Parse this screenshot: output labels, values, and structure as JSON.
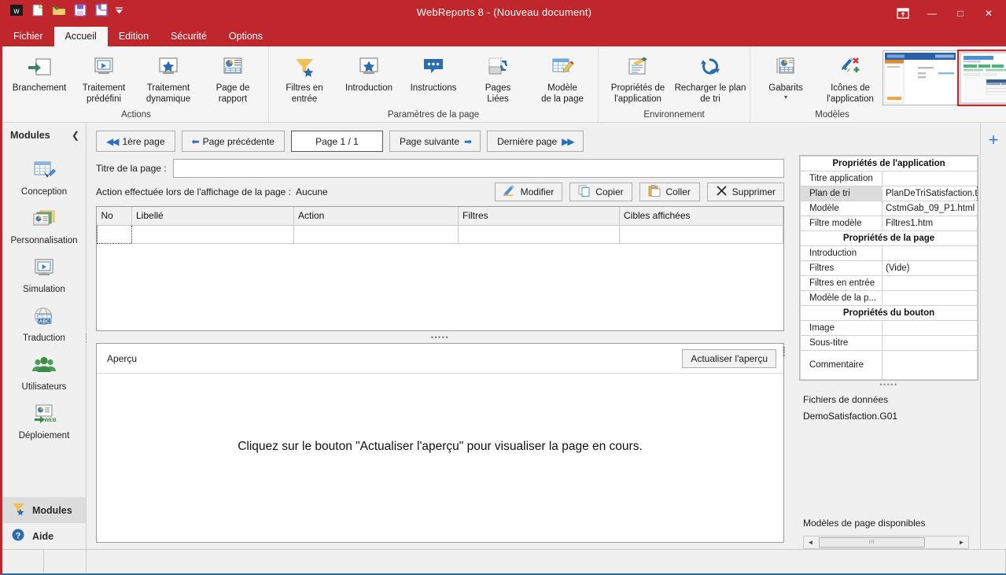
{
  "window": {
    "title": "WebReports 8 - (Nouveau document)",
    "quick_access": [
      "app-logo-icon",
      "new-document-icon",
      "open-folder-icon",
      "save-icon",
      "save-as-icon",
      "customize-qat-caret-icon"
    ],
    "controls": {
      "ribbon_display": "ribbon-display-options-icon",
      "minimize": "—",
      "maximize": "□",
      "close": "✕"
    }
  },
  "menu": {
    "tabs": [
      {
        "label": "Fichier",
        "active": false
      },
      {
        "label": "Accueil",
        "active": true
      },
      {
        "label": "Edition",
        "active": false
      },
      {
        "label": "Sécurité",
        "active": false
      },
      {
        "label": "Options",
        "active": false
      }
    ]
  },
  "ribbon": {
    "groups": [
      {
        "label": "Actions",
        "items": [
          {
            "label": "Branchement",
            "icon": "branch-icon",
            "caret": false
          },
          {
            "label": "Traitement\nprédéfini",
            "icon": "predefined-process-icon",
            "caret": false
          },
          {
            "label": "Traitement\ndynamique",
            "icon": "dynamic-process-icon",
            "caret": false
          },
          {
            "label": "Page de\nrapport",
            "icon": "report-page-icon",
            "caret": false
          }
        ]
      },
      {
        "label": "Paramètres de la page",
        "items": [
          {
            "label": "Filtres en\nentrée",
            "icon": "input-filters-icon",
            "caret": false
          },
          {
            "label": "Introduction",
            "icon": "introduction-icon",
            "caret": false
          },
          {
            "label": "Instructions",
            "icon": "instructions-icon",
            "caret": false
          },
          {
            "label": "Pages\nLiées",
            "icon": "linked-pages-icon",
            "caret": false
          },
          {
            "label": "Modèle\nde la page",
            "icon": "page-template-icon",
            "caret": false
          }
        ]
      },
      {
        "label": "Environnement",
        "items": [
          {
            "label": "Propriétés de\nl'application",
            "icon": "application-properties-icon",
            "caret": false
          },
          {
            "label": "Recharger le\nplan de tri",
            "icon": "reload-sort-plan-icon",
            "caret": false
          }
        ]
      },
      {
        "label": "Modèles",
        "items": [
          {
            "label": "Gabarits",
            "icon": "templates-icon",
            "caret": true
          },
          {
            "label": "Icônes de\nl'application",
            "icon": "application-icons-icon",
            "caret": false
          }
        ],
        "gallery": {
          "thumbnails": [
            {
              "name": "template-thumb-1",
              "selected": false
            },
            {
              "name": "template-thumb-2",
              "selected": true
            }
          ],
          "scroll": [
            "▲",
            "▼",
            "▼"
          ]
        }
      }
    ],
    "collapse_icon": "collapse-ribbon-icon"
  },
  "sidebar": {
    "title": "Modules",
    "collapse_icon": "chevron-left-icon",
    "items": [
      {
        "label": "Conception",
        "icon": "design-grid-icon"
      },
      {
        "label": "Personnalisation",
        "icon": "customization-icon"
      },
      {
        "label": "Simulation",
        "icon": "simulation-screen-icon"
      },
      {
        "label": "Traduction",
        "icon": "translation-globe-abc-icon"
      },
      {
        "label": "Utilisateurs",
        "icon": "users-group-icon"
      },
      {
        "label": "Déploiement",
        "icon": "deployment-web-icon"
      }
    ],
    "bottom": [
      {
        "label": "Modules",
        "icon": "modules-funnel-icon",
        "active": true
      },
      {
        "label": "Aide",
        "icon": "help-question-icon",
        "active": false
      }
    ]
  },
  "center": {
    "pager": {
      "first": "1ère page",
      "previous": "Page précédente",
      "indicator": "Page 1 / 1",
      "next": "Page suivante",
      "last": "Dernière page"
    },
    "page_title": {
      "label": "Titre de la page :",
      "value": "",
      "placeholder": ""
    },
    "display_action": {
      "label": "Action effectuée lors de l'affichage de la page :",
      "value": "Aucune"
    },
    "toolbar": [
      {
        "label": "Modifier",
        "icon": "edit-icon"
      },
      {
        "label": "Copier",
        "icon": "copy-icon"
      },
      {
        "label": "Coller",
        "icon": "paste-icon"
      },
      {
        "label": "Supprimer",
        "icon": "delete-x-icon"
      }
    ],
    "grid": {
      "columns": [
        "No",
        "Libellé",
        "Action",
        "Filtres",
        "Cibles affichées"
      ],
      "rows": [
        {
          "No": "",
          "Libellé": "",
          "Action": "",
          "Filtres": "",
          "Cibles affichées": ""
        }
      ]
    },
    "preview": {
      "label": "Aperçu",
      "refresh_button": "Actualiser l'aperçu",
      "message": "Cliquez sur le bouton \"Actualiser l'aperçu\" pour visualiser la page en cours."
    }
  },
  "rightpanel": {
    "properties": [
      {
        "type": "section",
        "label": "Propriétés de l'application"
      },
      {
        "type": "row",
        "key": "Titre application",
        "value": "",
        "highlight": false,
        "active": false
      },
      {
        "type": "row",
        "key": "Plan de tri",
        "value": "PlanDeTriSatisfaction.tri",
        "highlight": true,
        "active": true
      },
      {
        "type": "row",
        "key": "Modèle",
        "value": "CstmGab_09_P1.html",
        "highlight": false,
        "active": false
      },
      {
        "type": "row",
        "key": "Filtre modèle",
        "value": "Filtres1.htm",
        "highlight": false,
        "active": false
      },
      {
        "type": "section",
        "label": "Propriétés de la page"
      },
      {
        "type": "row",
        "key": "Introduction",
        "value": "",
        "highlight": false,
        "active": false
      },
      {
        "type": "row",
        "key": "Filtres",
        "value": "(Vide)",
        "highlight": false,
        "active": false
      },
      {
        "type": "row",
        "key": "Filtres en entrée",
        "value": "",
        "highlight": false,
        "active": false
      },
      {
        "type": "row",
        "key": "Modèle de la p...",
        "value": "",
        "highlight": false,
        "active": false
      },
      {
        "type": "section",
        "label": "Propriétés du bouton"
      },
      {
        "type": "row",
        "key": "Image",
        "value": "",
        "highlight": false,
        "active": false
      },
      {
        "type": "row",
        "key": "Sous-titre",
        "value": "",
        "highlight": false,
        "active": false
      },
      {
        "type": "row",
        "key": "Commentaire",
        "value": "",
        "highlight": false,
        "active": false,
        "tall": true
      }
    ],
    "data_files_label": "Fichiers de données",
    "data_files": [
      "DemoSatisfaction.G01"
    ],
    "page_templates_label": "Modèles de page disponibles",
    "scrollbar": {
      "left": "◄",
      "right": "►",
      "grip": "III"
    }
  },
  "rightstrip": {
    "add_icon": "plus-icon"
  },
  "colors": {
    "accent": "#c0272d",
    "blue": "#2a6fbb",
    "ribbon_bg": "#f5f5f5",
    "panel_bg": "#f0f0f0",
    "selection": "#dcdcdc"
  }
}
